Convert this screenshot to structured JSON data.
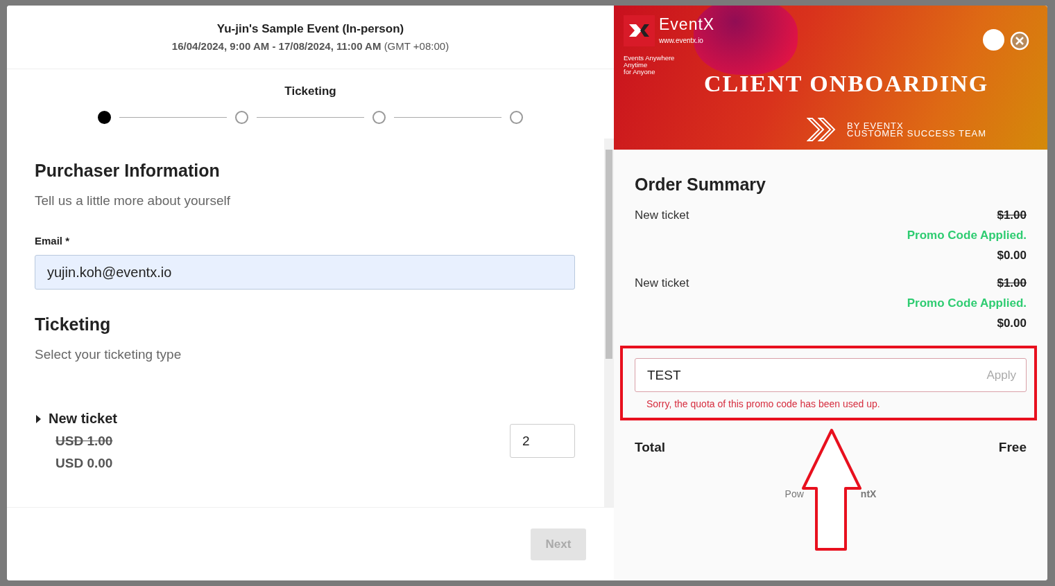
{
  "event": {
    "title": "Yu-jin's Sample Event (In-person)",
    "dates": "16/04/2024, 9:00 AM - 17/08/2024, 11:00 AM",
    "timezone": "(GMT +08:00)"
  },
  "stepper": {
    "label": "Ticketing",
    "steps": [
      {
        "selected": true
      },
      {
        "selected": false
      },
      {
        "selected": false
      },
      {
        "selected": false
      }
    ]
  },
  "purchaser": {
    "heading": "Purchaser Information",
    "subheading": "Tell us a little more about yourself",
    "email_label": "Email *",
    "email_value": "yujin.koh@eventx.io"
  },
  "ticketing": {
    "heading": "Ticketing",
    "subheading": "Select your ticketing type",
    "tickets": [
      {
        "name": "New ticket",
        "expanded": false,
        "original_price": "USD 1.00",
        "price": "USD 0.00",
        "quantity": "2"
      }
    ]
  },
  "footer": {
    "next_button": {
      "label": "Next",
      "disabled": true
    }
  },
  "banner": {
    "brand": "EventX",
    "url": "www.eventx.io",
    "tagline": [
      "Events Anywhere",
      "Anytime",
      "for Anyone"
    ],
    "title": "CLIENT ONBOARDING",
    "byline": [
      "BY EVENTX",
      "CUSTOMER SUCCESS TEAM"
    ]
  },
  "order_summary": {
    "heading": "Order Summary",
    "items": [
      {
        "name": "New ticket",
        "original_price": "$1.00",
        "promo_note": "Promo Code Applied.",
        "price": "$0.00"
      },
      {
        "name": "New ticket",
        "original_price": "$1.00",
        "promo_note": "Promo Code Applied.",
        "price": "$0.00"
      }
    ],
    "promo": {
      "value": "TEST",
      "apply_label": "Apply",
      "error": "Sorry, the quota of this promo code has been used up."
    },
    "total_label": "Total",
    "total_value": "Free",
    "powered_by": [
      "Pow",
      "ntX"
    ]
  }
}
